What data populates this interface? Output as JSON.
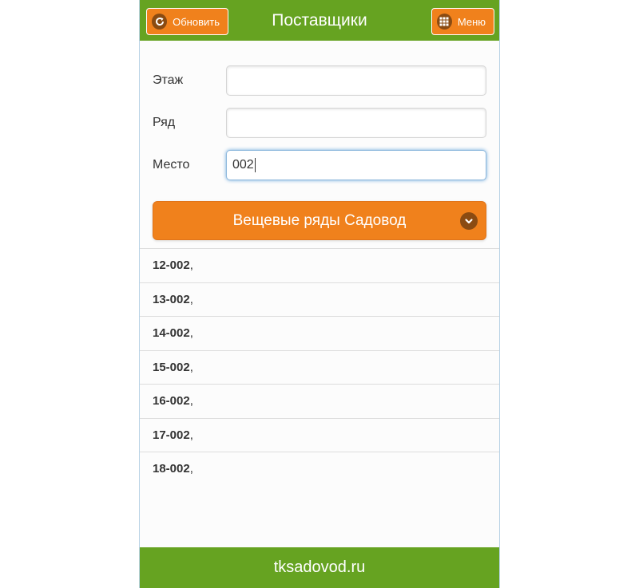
{
  "header": {
    "title": "Поставщики",
    "refresh_label": "Обновить",
    "menu_label": "Меню"
  },
  "form": {
    "floor_label": "Этаж",
    "floor_value": "",
    "row_label": "Ряд",
    "row_value": "",
    "place_label": "Место",
    "place_value": "002"
  },
  "select": {
    "value": "Вещевые ряды Садовод"
  },
  "results": [
    {
      "code": "12-002",
      "suffix": ","
    },
    {
      "code": "13-002",
      "suffix": ","
    },
    {
      "code": "14-002",
      "suffix": ","
    },
    {
      "code": "15-002",
      "suffix": ","
    },
    {
      "code": "16-002",
      "suffix": ","
    },
    {
      "code": "17-002",
      "suffix": ","
    },
    {
      "code": "18-002",
      "suffix": ","
    }
  ],
  "footer": {
    "text": "tksadovod.ru"
  },
  "colors": {
    "header_green": "#66a321",
    "accent_orange": "#f0811c",
    "icon_brown": "#8a4b12"
  },
  "icons": {
    "refresh": "refresh-icon",
    "menu": "grid-icon",
    "select": "chevron-down-icon"
  }
}
